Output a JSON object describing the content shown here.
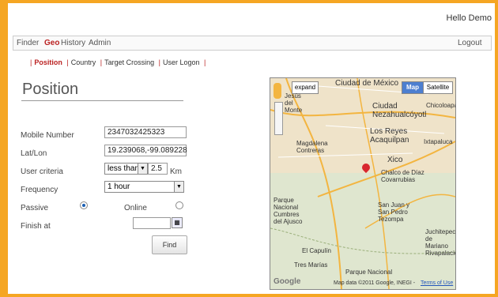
{
  "header": {
    "greeting": "Hello Demo"
  },
  "menu": {
    "finder": "Finder",
    "geo": "Geo",
    "history": "History",
    "admin": "Admin",
    "logout": "Logout"
  },
  "subnav": {
    "position": "Position",
    "country": "Country",
    "target_crossing": "Target Crossing",
    "user_logon": "User Logon"
  },
  "page_title": "Position",
  "form": {
    "mobile_label": "Mobile Number",
    "mobile_value": "2347032425323",
    "latlon_label": "Lat/Lon",
    "latlon_value": "19.239068,-99.089228",
    "criteria_label": "User criteria",
    "criteria_value": "less than",
    "criteria_number": "2.5",
    "criteria_unit": "Km",
    "frequency_label": "Frequency",
    "frequency_value": "1 hour",
    "passive_label": "Passive",
    "online_label": "Online",
    "finish_label": "Finish at",
    "find_button": "Find"
  },
  "map": {
    "expand": "expand",
    "map_tab": "Map",
    "satellite_tab": "Satellite",
    "labels": [
      "Ciudad de México",
      "Ciudad Nezahualcóyotl",
      "Chicoloapan",
      "Los Reyes Acaquilpan",
      "Ixtapaluca",
      "Xico",
      "Chalco de Díaz Covarrubias",
      "Magdalena Contreras",
      "Parque Nacional Cumbres del Ajusco",
      "San Juan y San Pedro Tezompa",
      "Juchitepec de Mariano Rivapalacio",
      "Tres Marías",
      "Parque Nacional",
      "El Capulín",
      "Jesús del Monte"
    ],
    "attribution": "Map data ©2011 Google, INEGI -",
    "terms": "Terms of Use",
    "logo": "Google"
  }
}
